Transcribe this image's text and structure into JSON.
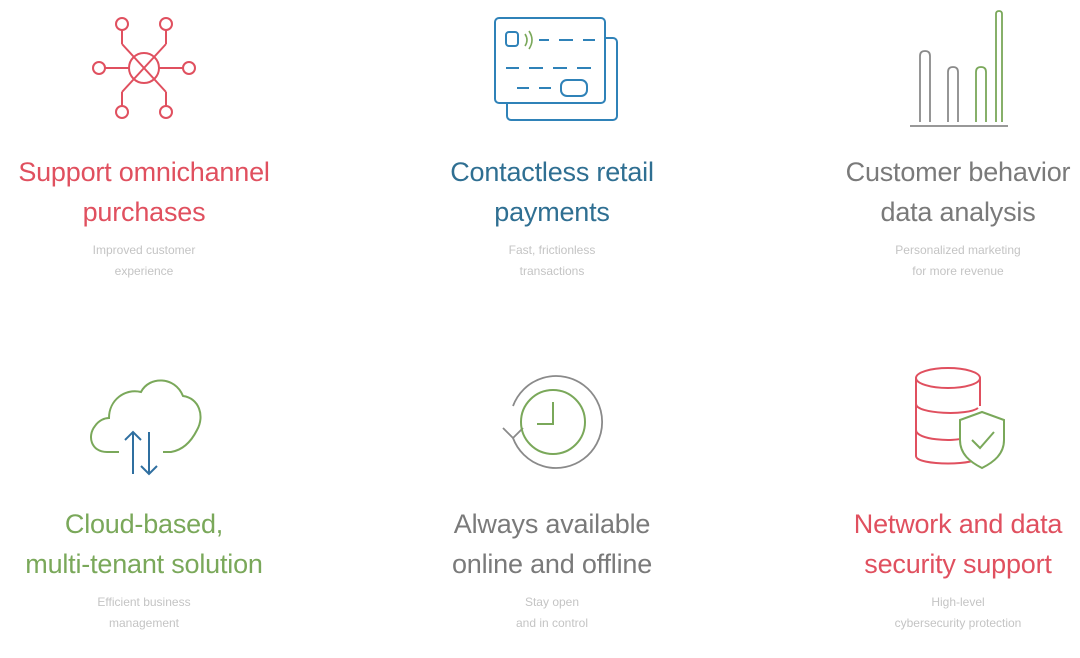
{
  "colors": {
    "red": "#e0505f",
    "blue": "#2f82b8",
    "teal_blue": "#2f6f92",
    "gray": "#7a7a7a",
    "green": "#7aa85a",
    "light_gray": "#c4c4c4",
    "dark_blue": "#2f6fa0"
  },
  "features": [
    {
      "icon": "network-hub-icon",
      "title_lines": [
        "Support omnichannel",
        "purchases"
      ],
      "subtitle_lines": [
        "Improved customer",
        "experience"
      ]
    },
    {
      "icon": "credit-cards-icon",
      "title_lines": [
        "Contactless retail",
        "payments"
      ],
      "subtitle_lines": [
        "Fast, frictionless",
        "transactions"
      ]
    },
    {
      "icon": "bar-chart-icon",
      "title_lines": [
        "Customer behavior",
        "data analysis"
      ],
      "subtitle_lines": [
        "Personalized marketing",
        "for more revenue"
      ]
    },
    {
      "icon": "cloud-sync-icon",
      "title_lines": [
        "Cloud-based,",
        "multi-tenant solution"
      ],
      "subtitle_lines": [
        "Efficient business",
        "management"
      ]
    },
    {
      "icon": "clock-refresh-icon",
      "title_lines": [
        "Always available",
        "online and offline"
      ],
      "subtitle_lines": [
        "Stay open",
        "and in control"
      ]
    },
    {
      "icon": "database-shield-icon",
      "title_lines": [
        "Network and data",
        "security support"
      ],
      "subtitle_lines": [
        "High-level",
        "cybersecurity protection"
      ]
    }
  ]
}
